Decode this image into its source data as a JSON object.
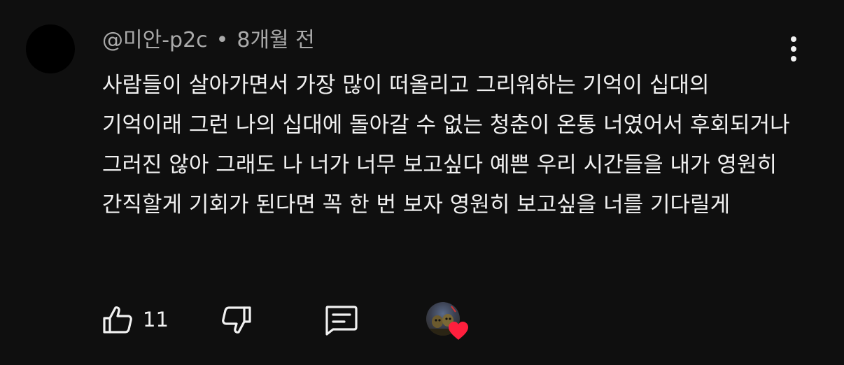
{
  "comment": {
    "author": "@미안-p2c",
    "separator": "•",
    "time": "8개월 전",
    "text": "사람들이 살아가면서 가장 많이 떠올리고 그리워하는 기억이 십대의 기억이래 그런 나의 십대에 돌아갈 수 없는 청춘이 온통 너였어서 후회되거나 그러진 않아 그래도 나 너가 너무 보고싶다 예쁜 우리 시간들을 내가 영원히 간직할게 기회가 된다면 꼭 한 번 보자 영원히 보고싶을 너를 기다릴게"
  },
  "actions": {
    "like_count": "11",
    "like_icon": "thumbs-up-icon",
    "dislike_icon": "thumbs-down-icon",
    "reply_icon": "reply-icon",
    "creator_heart_icon": "creator-heart-icon"
  },
  "colors": {
    "background": "#0f0f0f",
    "text": "#f1f1f1",
    "meta": "#aaaaaa",
    "heart": "#ff1f3d"
  }
}
